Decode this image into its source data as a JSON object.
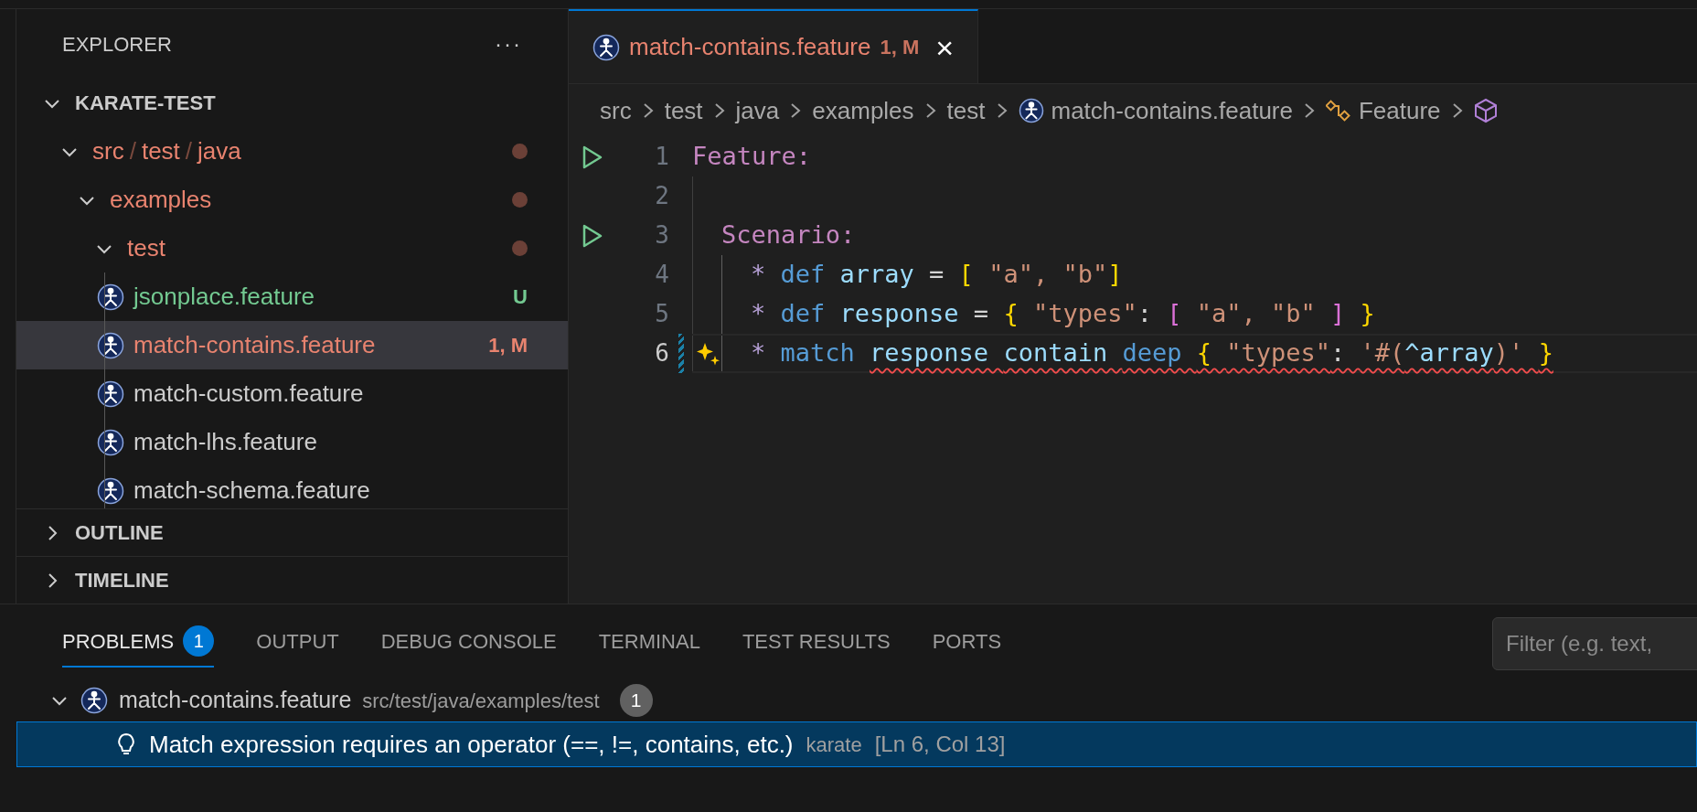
{
  "sidebar": {
    "title": "EXPLORER",
    "more": "···",
    "tree": [
      {
        "kind": "root",
        "label": "KARATE-TEST",
        "expanded": true,
        "children": [
          {
            "kind": "folder",
            "segments": [
              "src",
              "test",
              "java"
            ],
            "separator": "/",
            "expanded": true,
            "color": "#e8836f",
            "dot": true,
            "children": [
              {
                "kind": "folder",
                "segments": [
                  "examples"
                ],
                "expanded": true,
                "color": "#e8836f",
                "dot": true,
                "children": [
                  {
                    "kind": "folder",
                    "segments": [
                      "test"
                    ],
                    "expanded": true,
                    "color": "#e8836f",
                    "dot": true,
                    "children": [
                      {
                        "kind": "file",
                        "label": "jsonplace.feature",
                        "color": "#73c991",
                        "badge": "U",
                        "selected": false
                      },
                      {
                        "kind": "file",
                        "label": "match-contains.feature",
                        "color": "#e8836f",
                        "badge": "1, M",
                        "selected": true
                      },
                      {
                        "kind": "file",
                        "label": "match-custom.feature",
                        "color": "#cccccc",
                        "selected": false
                      },
                      {
                        "kind": "file",
                        "label": "match-lhs.feature",
                        "color": "#cccccc",
                        "selected": false
                      },
                      {
                        "kind": "file",
                        "label": "match-schema.feature",
                        "color": "#cccccc",
                        "selected": false
                      }
                    ]
                  }
                ]
              }
            ]
          }
        ]
      }
    ],
    "sections": [
      {
        "label": "OUTLINE",
        "expanded": false
      },
      {
        "label": "TIMELINE",
        "expanded": false
      }
    ]
  },
  "editor": {
    "tabs": [
      {
        "label": "match-contains.feature",
        "badge": "1, M",
        "selected": true,
        "close": "×"
      }
    ],
    "breadcrumb": [
      {
        "kind": "folder",
        "label": "src"
      },
      {
        "kind": "folder",
        "label": "test"
      },
      {
        "kind": "folder",
        "label": "java"
      },
      {
        "kind": "folder",
        "label": "examples"
      },
      {
        "kind": "folder",
        "label": "test"
      },
      {
        "kind": "file",
        "label": "match-contains.feature"
      },
      {
        "kind": "symbol",
        "label": "Feature"
      },
      {
        "kind": "cube"
      }
    ],
    "lines": [
      {
        "number": "1",
        "kind": "feature",
        "run": true,
        "current": false,
        "sparkle": false,
        "modified": false,
        "tokens": [
          {
            "text": "Feature:",
            "kind": "keyword"
          }
        ]
      },
      {
        "number": "2",
        "run": false,
        "current": false,
        "sparkle": false,
        "modified": false
      },
      {
        "number": "3",
        "kind": "scenario",
        "run": true,
        "current": false,
        "sparkle": false,
        "modified": false,
        "tokens": [
          {
            "text": "Scenario:",
            "kind": "keyword"
          }
        ]
      },
      {
        "number": "4",
        "kind": "step",
        "run": false,
        "current": false,
        "sparkle": false,
        "modified": false,
        "tokens": [
          {
            "text": "* ",
            "kind": "star"
          },
          {
            "text": "def ",
            "kind": "def"
          },
          {
            "text": "array ",
            "kind": "var"
          },
          {
            "text": "= ",
            "kind": "plain"
          },
          {
            "text": "[ ",
            "kind": "bracket1"
          },
          {
            "text": "\"a\", \"b\"",
            "kind": "string"
          },
          {
            "text": "]",
            "kind": "bracket1"
          }
        ]
      },
      {
        "number": "5",
        "kind": "step",
        "run": false,
        "current": false,
        "sparkle": false,
        "modified": false,
        "tokens": [
          {
            "text": "* ",
            "kind": "star"
          },
          {
            "text": "def ",
            "kind": "def"
          },
          {
            "text": "response ",
            "kind": "var"
          },
          {
            "text": "= ",
            "kind": "plain"
          },
          {
            "text": "{ ",
            "kind": "bracket1"
          },
          {
            "text": "\"types\"",
            "kind": "string"
          },
          {
            "text": ": ",
            "kind": "plain"
          },
          {
            "text": "[ ",
            "kind": "bracket2"
          },
          {
            "text": "\"a\", \"b\" ",
            "kind": "string"
          },
          {
            "text": "] ",
            "kind": "bracket2"
          },
          {
            "text": "}",
            "kind": "bracket1"
          }
        ]
      },
      {
        "number": "6",
        "kind": "step",
        "run": false,
        "current": true,
        "sparkle": true,
        "modified": true,
        "tokens": [
          {
            "text": "* ",
            "kind": "star"
          },
          {
            "text": "match ",
            "kind": "def"
          }
        ],
        "error_tokens": [
          {
            "text": "response ",
            "kind": "var"
          },
          {
            "text": "contain ",
            "kind": "var"
          },
          {
            "text": "deep ",
            "kind": "def"
          },
          {
            "text": "{ ",
            "kind": "bracket1"
          },
          {
            "text": "\"types\"",
            "kind": "string"
          },
          {
            "text": ": ",
            "kind": "plain"
          },
          {
            "text": "'#(",
            "kind": "string"
          },
          {
            "text": "^array",
            "kind": "var"
          },
          {
            "text": ")' ",
            "kind": "string"
          },
          {
            "text": "}",
            "kind": "bracket1"
          }
        ]
      }
    ]
  },
  "panel": {
    "tabs": [
      {
        "label": "PROBLEMS",
        "count": "1",
        "selected": true
      },
      {
        "label": "OUTPUT",
        "selected": false
      },
      {
        "label": "DEBUG CONSOLE",
        "selected": false
      },
      {
        "label": "TERMINAL",
        "selected": false
      },
      {
        "label": "TEST RESULTS",
        "selected": false
      },
      {
        "label": "PORTS",
        "selected": false
      }
    ],
    "filter": {
      "placeholder": "Filter (e.g. text,"
    },
    "groups": [
      {
        "file": "match-contains.feature",
        "path": "src/test/java/examples/test",
        "count": "1",
        "expanded": true,
        "problems": [
          {
            "message": "Match expression requires an operator (==, !=, contains, etc.)",
            "source": "karate",
            "location": "[Ln 6, Col 13]",
            "selected": true
          }
        ]
      }
    ]
  }
}
